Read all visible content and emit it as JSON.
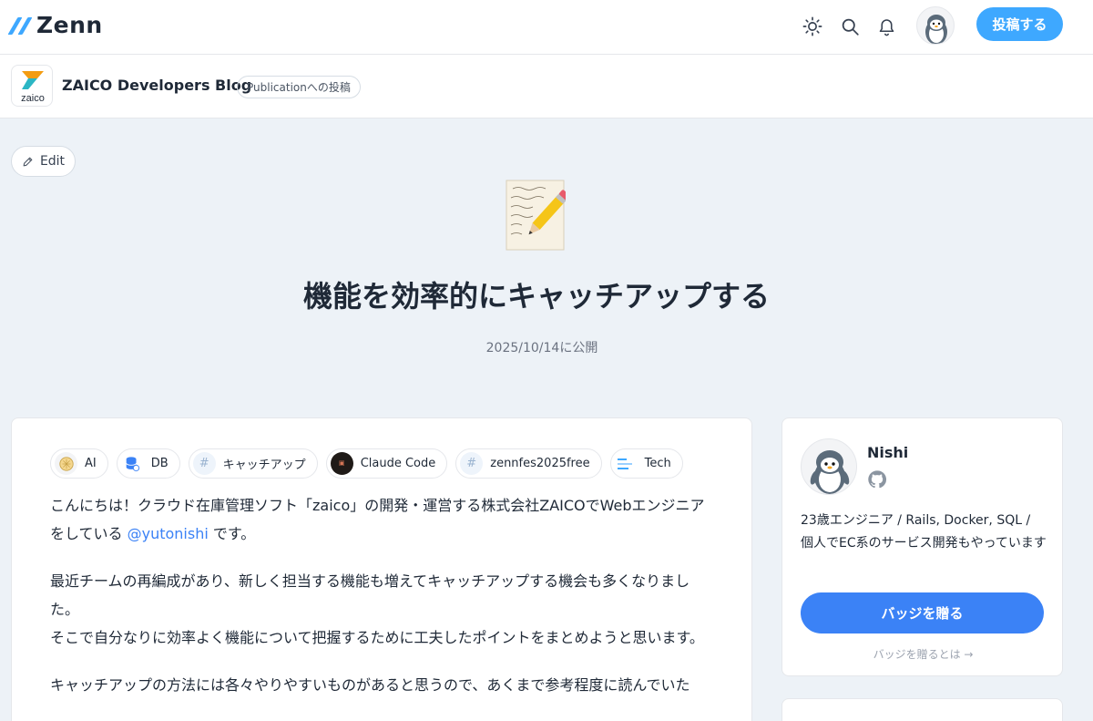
{
  "header": {
    "logo_text": "Zenn",
    "post_button": "投稿する",
    "icons": [
      "theme-icon",
      "search-icon",
      "bell-icon"
    ]
  },
  "publication": {
    "logo_text": "zaico",
    "name": "ZAICO Developers Blog",
    "badge": "Publicationへの投稿"
  },
  "article": {
    "edit_label": "Edit",
    "emoji": "📝",
    "title": "機能を効率的にキャッチアップする",
    "date": "2025/10/14に公開",
    "tags": [
      {
        "label": "AI"
      },
      {
        "label": "DB"
      },
      {
        "label": "キャッチアップ"
      },
      {
        "label": "Claude Code"
      },
      {
        "label": "zennfes2025free"
      },
      {
        "label": "Tech"
      }
    ],
    "p1_before": "こんにちは！クラウド在庫管理ソフト「zaico」の開発・運営する株式会社ZAICOでWebエンジニアをしている ",
    "p1_mention": "@yutonishi",
    "p1_after": " です。",
    "p2_line1": "最近チームの再編成があり、新しく担当する機能も増えてキャッチアップする機会も多くなりました。",
    "p2_line2": "そこで自分なりに効率よく機能について把握するために工夫したポイントをまとめようと思います。",
    "p3": "キャッチアップの方法には各々やりやすいものがあると思うので、あくまで参考程度に読んでいた"
  },
  "author": {
    "name": "Nishi",
    "bio": "23歳エンジニア / Rails, Docker, SQL / 個人でEC系のサービス開発もやっています",
    "badge_button": "バッジを贈る",
    "badge_link": "バッジを贈るとは →"
  },
  "colors": {
    "brand": "#3ea8ff",
    "primary_button": "#3b82f6",
    "background": "#edf2f7"
  }
}
